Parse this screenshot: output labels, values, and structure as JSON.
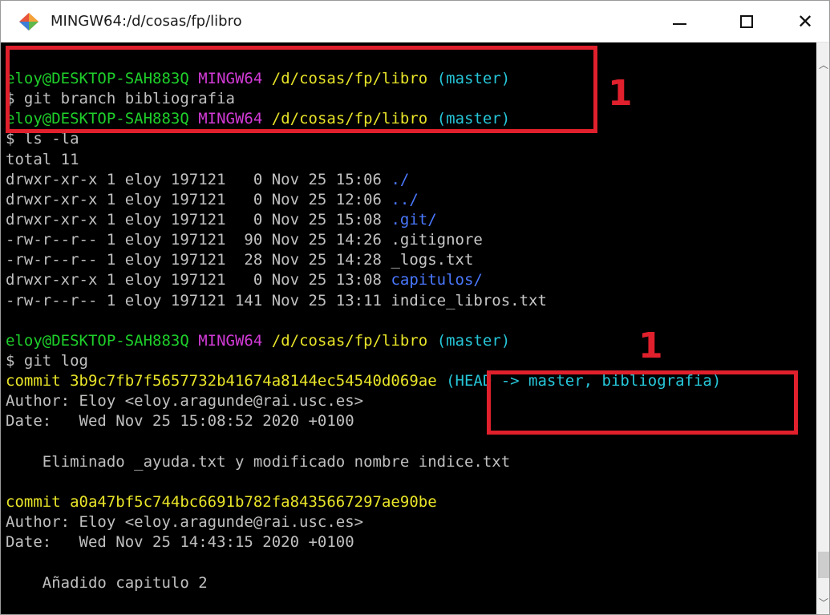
{
  "window": {
    "title": "MINGW64:/d/cosas/fp/libro",
    "minimize_glyph": "—",
    "maximize_glyph": "☐",
    "close_glyph": "✕",
    "icon": "git-bash-icon"
  },
  "terminal": {
    "prompt": {
      "user_host": "eloy@DESKTOP-SAH883Q",
      "system": "MINGW64",
      "path": "/d/cosas/fp/libro",
      "branch": "(master)"
    },
    "cmd1": "$ git branch bibliografia",
    "cmd2": "$ ls -la",
    "total": "total 11",
    "ls_rows": [
      {
        "meta": "drwxr-xr-x 1 eloy 197121   0 Nov 25 15:06 ",
        "name": "./",
        "color": "blue"
      },
      {
        "meta": "drwxr-xr-x 1 eloy 197121   0 Nov 25 12:06 ",
        "name": "../",
        "color": "blue"
      },
      {
        "meta": "drwxr-xr-x 1 eloy 197121   0 Nov 25 15:08 ",
        "name": ".git/",
        "color": "blue"
      },
      {
        "meta": "-rw-r--r-- 1 eloy 197121  90 Nov 25 14:26 ",
        "name": ".gitignore",
        "color": "white"
      },
      {
        "meta": "-rw-r--r-- 1 eloy 197121  28 Nov 25 14:28 ",
        "name": "_logs.txt",
        "color": "white"
      },
      {
        "meta": "drwxr-xr-x 1 eloy 197121   0 Nov 25 13:08 ",
        "name": "capitulos/",
        "color": "blue"
      },
      {
        "meta": "-rw-r--r-- 1 eloy 197121 141 Nov 25 13:11 ",
        "name": "indice_libros.txt",
        "color": "white"
      }
    ],
    "cmd3": "$ git log",
    "commits": [
      {
        "hash_line": "commit 3b9c7fb7f5657732b41674a8144ec54540d069ae",
        "refs": "(HEAD -> master, bibliografia)",
        "author": "Author: Eloy <eloy.aragunde@rai.usc.es>",
        "date": "Date:   Wed Nov 25 15:08:52 2020 +0100",
        "message": "    Eliminado _ayuda.txt y modificado nombre indice.txt"
      },
      {
        "hash_line": "commit a0a47bf5c744bc6691b782fa8435667297ae90be",
        "refs": "",
        "author": "Author: Eloy <eloy.aragunde@rai.usc.es>",
        "date": "Date:   Wed Nov 25 14:43:15 2020 +0100",
        "message": "    Añadido capitulo 2"
      }
    ]
  },
  "annotations": {
    "label_a": "1",
    "label_b": "1"
  },
  "colors": {
    "annotation_red": "#e0202c",
    "prompt_green": "#1ecf2a",
    "prompt_magenta": "#d23ad6",
    "path_yellow": "#e8e428",
    "branch_cyan": "#26c6d8",
    "dir_blue": "#4a78ff"
  }
}
